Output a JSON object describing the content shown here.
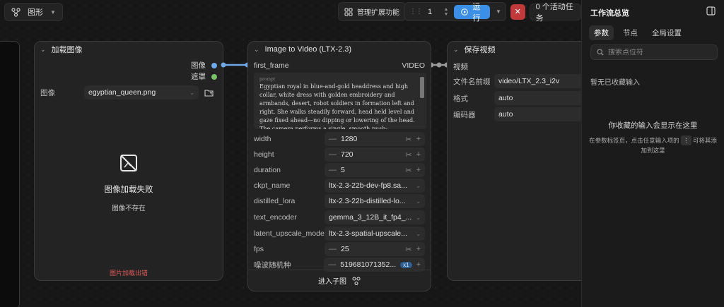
{
  "toolbar": {
    "mode_label": "图形",
    "manage_ext_label": "管理扩展功能",
    "queue_count": "1",
    "run_label": "运行",
    "active_tasks_label": "0 个活动任务"
  },
  "load_image_node": {
    "title": "加载图像",
    "output_image": "图像",
    "output_mask": "遮罩",
    "image_label": "图像",
    "image_value": "egyptian_queen.png",
    "failed_title": "图像加载失败",
    "failed_sub": "图像不存在",
    "error_label": "图片加载出错"
  },
  "ltx_node": {
    "title": "Image to Video (LTX-2.3)",
    "input_first_frame": "first_frame",
    "output_video": "VIDEO",
    "prompt_label": "prompt",
    "prompt_text": "Egyptian royal in blue-and-gold headdress and high collar, white dress with golden embroidery and armbands, desert, robot soldiers in formation left and right. She walks steadily forward, head held level and gaze fixed ahead—no dipping or lowering of the head. The camera performs a single, smooth push-",
    "widgets": [
      {
        "label": "width",
        "value": "1280"
      },
      {
        "label": "height",
        "value": "720"
      },
      {
        "label": "duration",
        "value": "5"
      },
      {
        "label": "ckpt_name",
        "value": "ltx-2.3-22b-dev-fp8.sa..."
      },
      {
        "label": "distilled_lora",
        "value": "ltx-2.3-22b-distilled-lo..."
      },
      {
        "label": "text_encoder",
        "value": "gemma_3_12B_it_fp4_..."
      },
      {
        "label": "latent_upscale_model",
        "value": "ltx-2.3-spatial-upscale..."
      },
      {
        "label": "fps",
        "value": "25"
      },
      {
        "label": "噪波随机种",
        "value": "519681071352...",
        "badge": "x1"
      }
    ],
    "subgraph_label": "进入子图"
  },
  "save_video_node": {
    "title": "保存视频",
    "input_video": "视频",
    "widgets": [
      {
        "label": "文件名前缀",
        "value": "video/LTX_2.3_i2v"
      },
      {
        "label": "格式",
        "value": "auto"
      },
      {
        "label": "编码器",
        "value": "auto"
      }
    ]
  },
  "panel": {
    "title": "工作流总览",
    "tabs": [
      "参数",
      "节点",
      "全局设置"
    ],
    "search_placeholder": "搜索点位符",
    "no_favorites": "暂无已收藏输入",
    "empty_title": "你收藏的输入会显示在这里",
    "empty_desc_1": "在参数标签页，点击任意输入项的",
    "empty_desc_2": "可将其添",
    "empty_desc_3": "加到这里"
  },
  "colors": {
    "accent": "#3b8fe6",
    "stop": "#c0393b",
    "image_link": "#6fa8e8",
    "mask_dot": "#79c46b",
    "video_link": "#9a9a9a",
    "error_text": "#e05a5a"
  }
}
